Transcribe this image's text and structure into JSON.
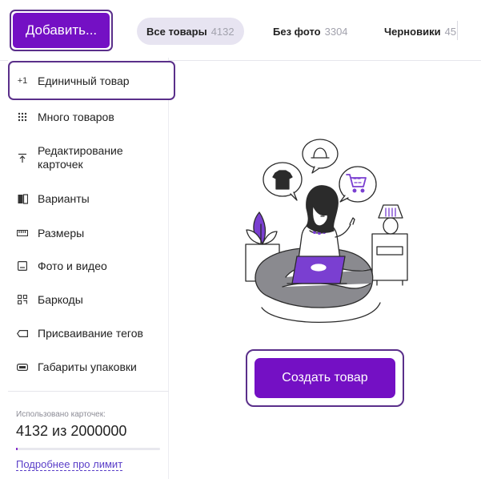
{
  "toolbar": {
    "add_label": "Добавить...",
    "tabs": [
      {
        "label": "Все товары",
        "count": "4132"
      },
      {
        "label": "Без фото",
        "count": "3304"
      },
      {
        "label": "Черновики",
        "count": "45"
      }
    ]
  },
  "menu": {
    "items": [
      {
        "icon_text": "+1",
        "label": "Единичный товар"
      },
      {
        "icon": "grid-dots-icon",
        "label": "Много товаров"
      },
      {
        "icon": "upload-icon",
        "label": "Редактирование\nкарточек"
      },
      {
        "icon": "variants-icon",
        "label": "Варианты"
      },
      {
        "icon": "ruler-icon",
        "label": "Размеры"
      },
      {
        "icon": "image-icon",
        "label": "Фото и видео"
      },
      {
        "icon": "qr-code-icon",
        "label": "Баркоды"
      },
      {
        "icon": "tag-icon",
        "label": "Присваивание тегов"
      },
      {
        "icon": "package-size-icon",
        "label": "Габариты упаковки"
      }
    ],
    "usage": {
      "caption": "Использовано карточек:",
      "value": "4132 из 2000000",
      "used": 4132,
      "limit": 2000000
    },
    "limit_link": "Подробнее про лимит"
  },
  "main": {
    "create_label": "Создать товар"
  },
  "colors": {
    "accent": "#7410c4",
    "highlight_frame": "#5a2f8a",
    "active_tab_bg": "#e7e4f1",
    "link": "#5a3ec8",
    "illustration_purple": "#7a3fd1",
    "illustration_gray": "#8a8a8f"
  }
}
